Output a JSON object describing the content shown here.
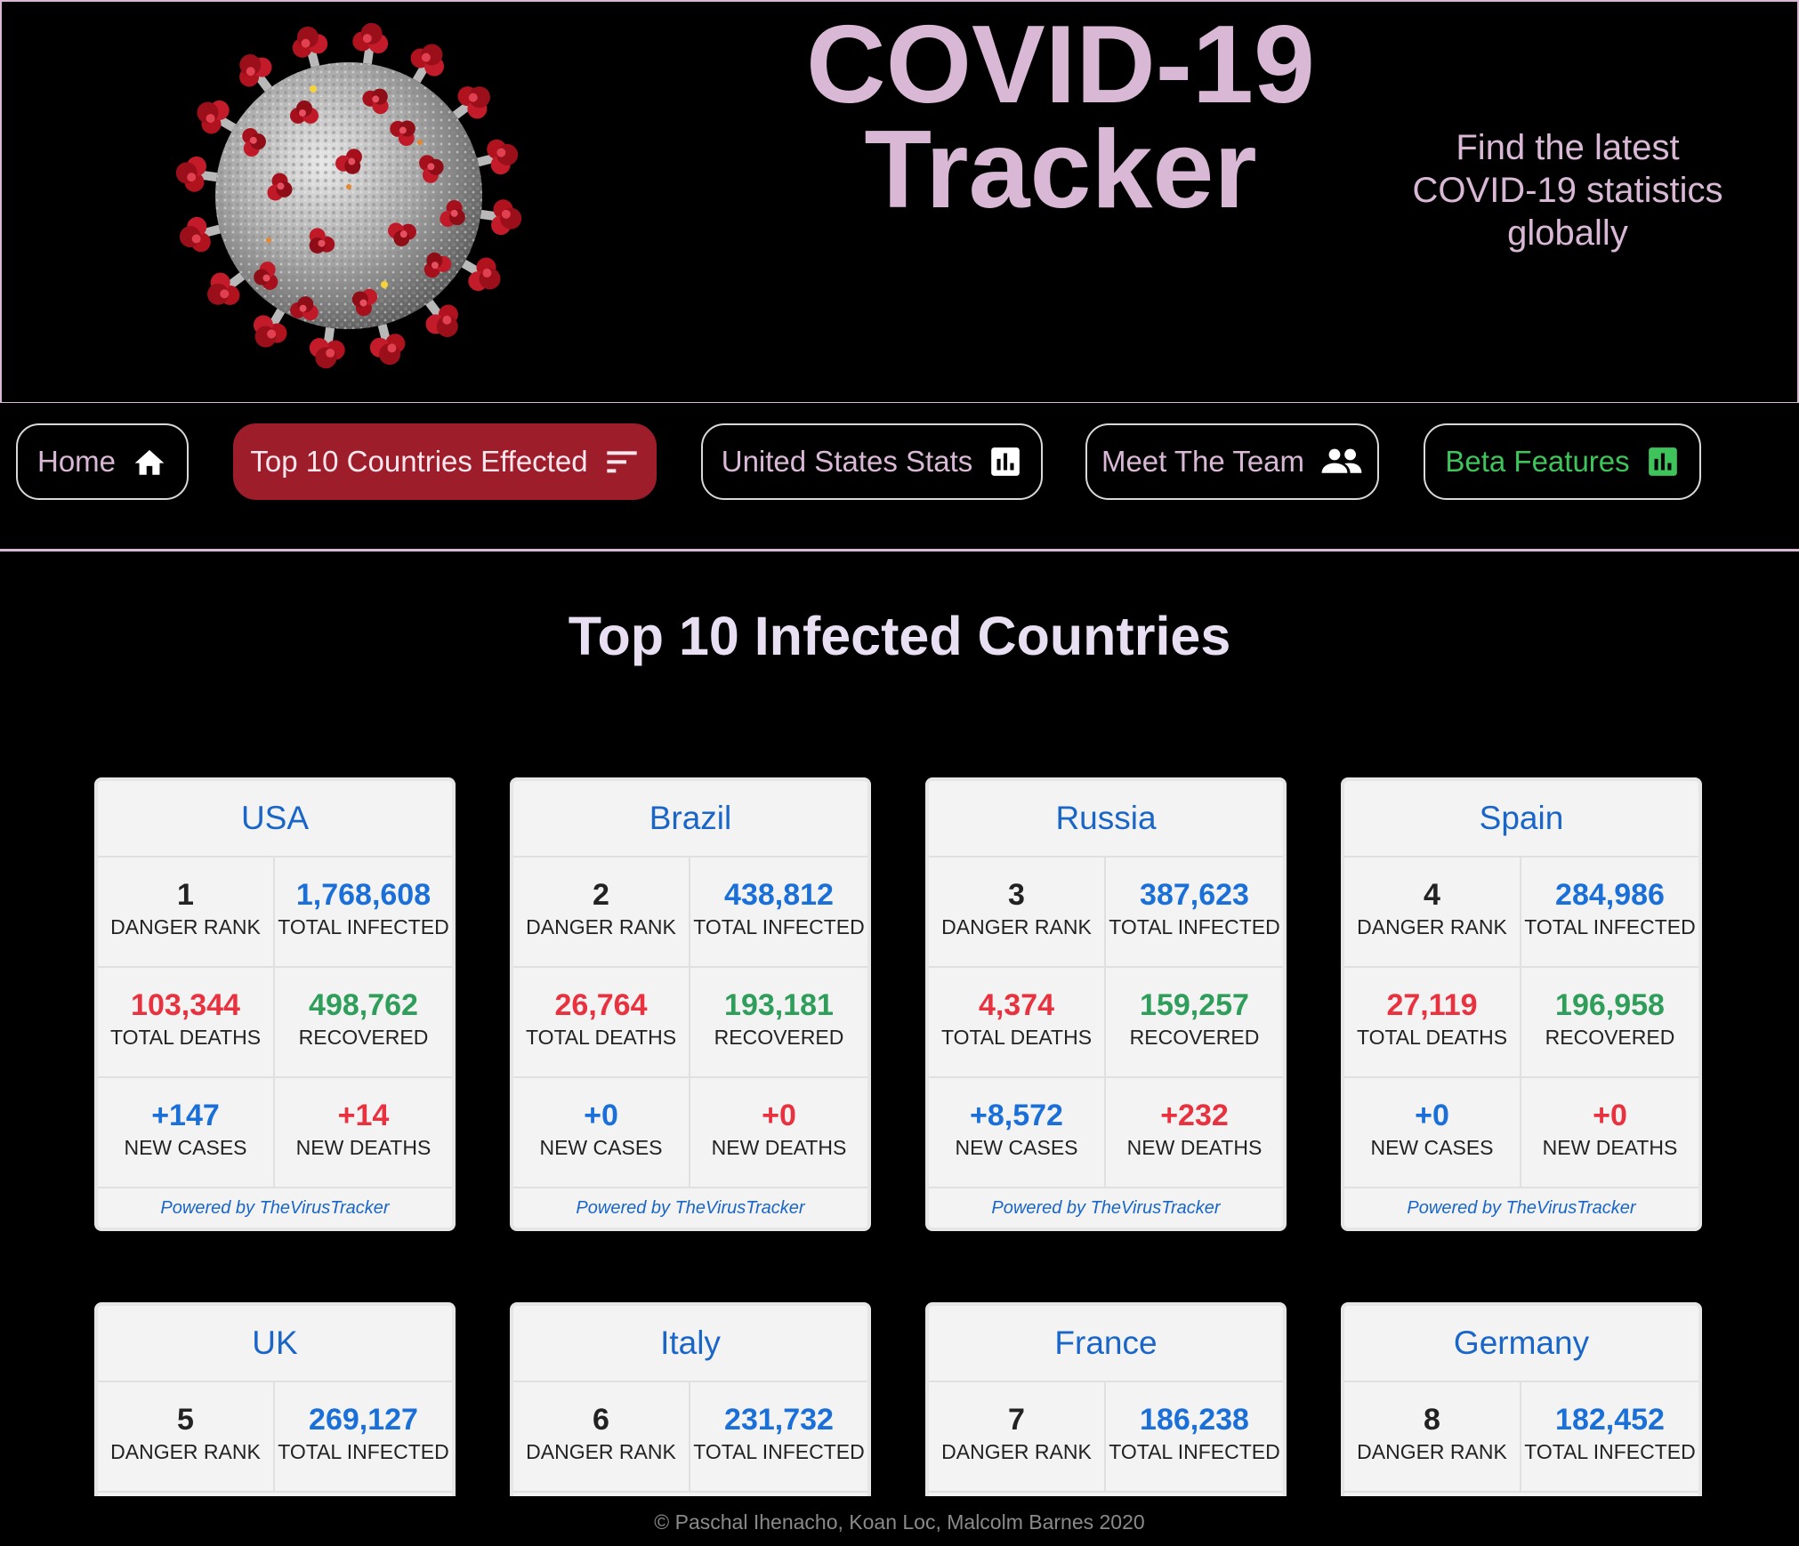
{
  "header": {
    "title_line1": "COVID-19",
    "title_line2": "Tracker",
    "tagline": "Find the latest COVID-19 statistics globally"
  },
  "nav": [
    {
      "label": "Home",
      "icon": "home-icon"
    },
    {
      "label": "Top 10 Countries Effected",
      "icon": "sort-icon"
    },
    {
      "label": "United States Stats",
      "icon": "bar-chart-icon"
    },
    {
      "label": "Meet The Team",
      "icon": "people-icon"
    },
    {
      "label": "Beta Features",
      "icon": "bar-chart-icon"
    }
  ],
  "colors": {
    "accent": "#d9b8d6",
    "active_nav": "#9d1d2b",
    "beta_green": "#3ec45a",
    "blue": "#1a70d8",
    "red": "#e8323f",
    "green": "#2e9e5a"
  },
  "section_title": "Top 10 Infected Countries",
  "labels": {
    "danger_rank": "DANGER RANK",
    "total_infected": "TOTAL INFECTED",
    "total_deaths": "TOTAL DEATHS",
    "recovered": "RECOVERED",
    "new_cases": "NEW CASES",
    "new_deaths": "NEW DEATHS",
    "powered_by": "Powered by TheVirusTracker"
  },
  "countries": [
    {
      "name": "USA",
      "rank": "1",
      "total_infected": "1,768,608",
      "total_deaths": "103,344",
      "recovered": "498,762",
      "new_cases": "+147",
      "new_deaths": "+14"
    },
    {
      "name": "Brazil",
      "rank": "2",
      "total_infected": "438,812",
      "total_deaths": "26,764",
      "recovered": "193,181",
      "new_cases": "+0",
      "new_deaths": "+0"
    },
    {
      "name": "Russia",
      "rank": "3",
      "total_infected": "387,623",
      "total_deaths": "4,374",
      "recovered": "159,257",
      "new_cases": "+8,572",
      "new_deaths": "+232"
    },
    {
      "name": "Spain",
      "rank": "4",
      "total_infected": "284,986",
      "total_deaths": "27,119",
      "recovered": "196,958",
      "new_cases": "+0",
      "new_deaths": "+0"
    },
    {
      "name": "UK",
      "rank": "5",
      "total_infected": "269,127"
    },
    {
      "name": "Italy",
      "rank": "6",
      "total_infected": "231,732"
    },
    {
      "name": "France",
      "rank": "7",
      "total_infected": "186,238"
    },
    {
      "name": "Germany",
      "rank": "8",
      "total_infected": "182,452"
    }
  ],
  "footer": "© Paschal Ihenacho, Koan Loc, Malcolm Barnes 2020"
}
